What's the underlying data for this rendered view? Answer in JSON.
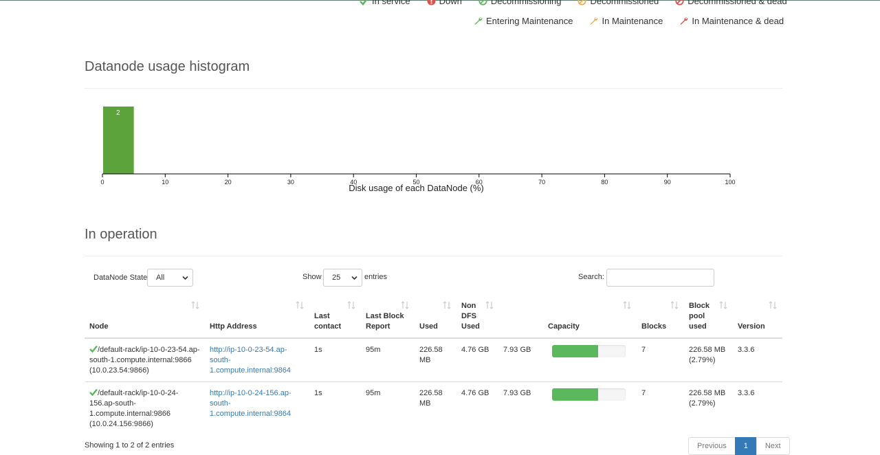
{
  "legend": {
    "row1": [
      {
        "label": "In service",
        "icon": "check-icon",
        "color": "#5cb85c"
      },
      {
        "label": "Down",
        "icon": "alert-circle-icon",
        "color": "#d9534f"
      },
      {
        "label": "Decommissioning",
        "icon": "ban-icon",
        "color": "#5cb85c"
      },
      {
        "label": "Decommissioned",
        "icon": "ban-icon",
        "color": "#f0ad4e"
      },
      {
        "label": "Decommissioned & dead",
        "icon": "ban-icon",
        "color": "#d9534f"
      }
    ],
    "row2": [
      {
        "label": "Entering Maintenance",
        "icon": "wrench-icon",
        "color": "#5cb85c"
      },
      {
        "label": "In Maintenance",
        "icon": "wrench-icon",
        "color": "#f0ad4e"
      },
      {
        "label": "In Maintenance & dead",
        "icon": "wrench-icon",
        "color": "#d9534f"
      }
    ]
  },
  "histogram": {
    "title": "Datanode usage histogram"
  },
  "chart_data": {
    "type": "bar",
    "title": "",
    "xlabel": "Disk usage of each DataNode (%)",
    "ylabel": "",
    "xlim": [
      0,
      100
    ],
    "xticks": [
      0,
      10,
      20,
      30,
      40,
      50,
      60,
      70,
      80,
      90,
      100
    ],
    "bins": [
      {
        "x0": 0,
        "x1": 5,
        "count": 2
      }
    ],
    "bar_color": "#5ca33c"
  },
  "operation": {
    "title": "In operation",
    "state_label": "DataNode State",
    "state_value": "All",
    "show_label": "Show",
    "show_value": "25",
    "entries_label": "entries",
    "search_label": "Search:",
    "search_value": "",
    "columns": [
      "Node",
      "Http Address",
      "Last contact",
      "Last Block Report",
      "Used",
      "Non DFS Used",
      "Capacity",
      "Blocks",
      "Block pool used",
      "Version"
    ],
    "rows": [
      {
        "node": "/default-rack/ip-10-0-23-54.ap-south-1.compute.internal:9866 (10.0.23.54:9866)",
        "http": "http://ip-10-0-23-54.ap-south-1.compute.internal:9864",
        "last_contact": "1s",
        "last_block_report": "95m",
        "used": "226.58 MB",
        "non_dfs": "4.76 GB",
        "capacity": "7.93 GB",
        "capacity_used_fraction": 0.63,
        "blocks": "7",
        "block_pool_used": "226.58 MB (2.79%)",
        "version": "3.3.6"
      },
      {
        "node": "/default-rack/ip-10-0-24-156.ap-south-1.compute.internal:9866 (10.0.24.156:9866)",
        "http": "http://ip-10-0-24-156.ap-south-1.compute.internal:9864",
        "last_contact": "1s",
        "last_block_report": "95m",
        "used": "226.58 MB",
        "non_dfs": "4.76 GB",
        "capacity": "7.93 GB",
        "capacity_used_fraction": 0.63,
        "blocks": "7",
        "block_pool_used": "226.58 MB (2.79%)",
        "version": "3.3.6"
      }
    ],
    "info": "Showing 1 to 2 of 2 entries",
    "pagination": {
      "previous": "Previous",
      "page": "1",
      "next": "Next"
    }
  }
}
